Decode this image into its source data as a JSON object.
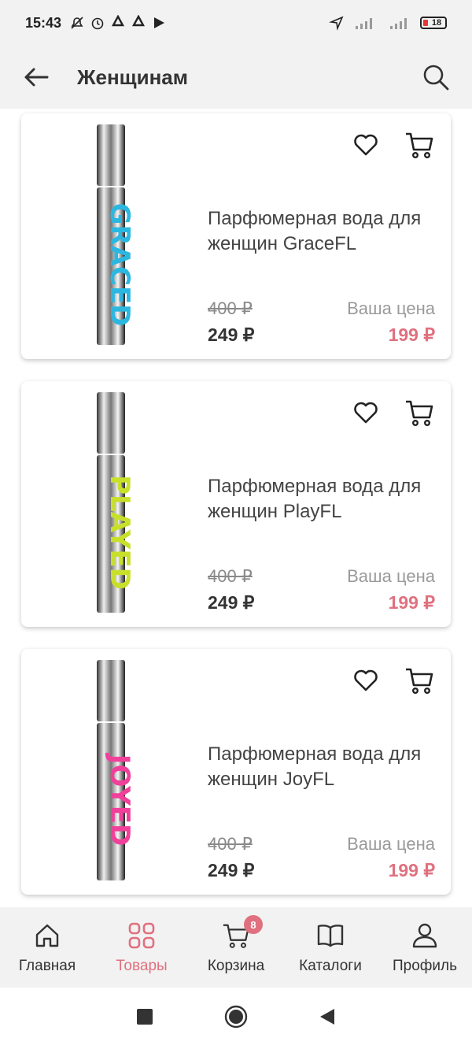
{
  "status_bar": {
    "time": "15:43",
    "battery": "18"
  },
  "header": {
    "title": "Женщинам"
  },
  "colors": {
    "accent": "#e0707f",
    "text": "#333333",
    "muted": "#8a8a8a"
  },
  "products": [
    {
      "name": "Парфюмерная вода для женщин GraceFL",
      "old_price": "400 ₽",
      "price": "249 ₽",
      "your_price_label": "Ваша цена",
      "your_price": "199 ₽",
      "bottle_color": "#2bb7e0",
      "bottle_text": "GRACED"
    },
    {
      "name": "Парфюмерная вода для женщин PlayFL",
      "old_price": "400 ₽",
      "price": "249 ₽",
      "your_price_label": "Ваша цена",
      "your_price": "199 ₽",
      "bottle_color": "#c8e02a",
      "bottle_text": "PLAYED"
    },
    {
      "name": "Парфюмерная вода для женщин JoyFL",
      "old_price": "400 ₽",
      "price": "249 ₽",
      "your_price_label": "Ваша цена",
      "your_price": "199 ₽",
      "bottle_color": "#f0409a",
      "bottle_text": "JOYED"
    }
  ],
  "bottom_nav": {
    "items": [
      {
        "label": "Главная",
        "icon": "home-icon"
      },
      {
        "label": "Товары",
        "icon": "grid-icon",
        "active": true
      },
      {
        "label": "Корзина",
        "icon": "cart-icon",
        "badge": "8"
      },
      {
        "label": "Каталоги",
        "icon": "book-icon"
      },
      {
        "label": "Профиль",
        "icon": "user-icon"
      }
    ]
  }
}
